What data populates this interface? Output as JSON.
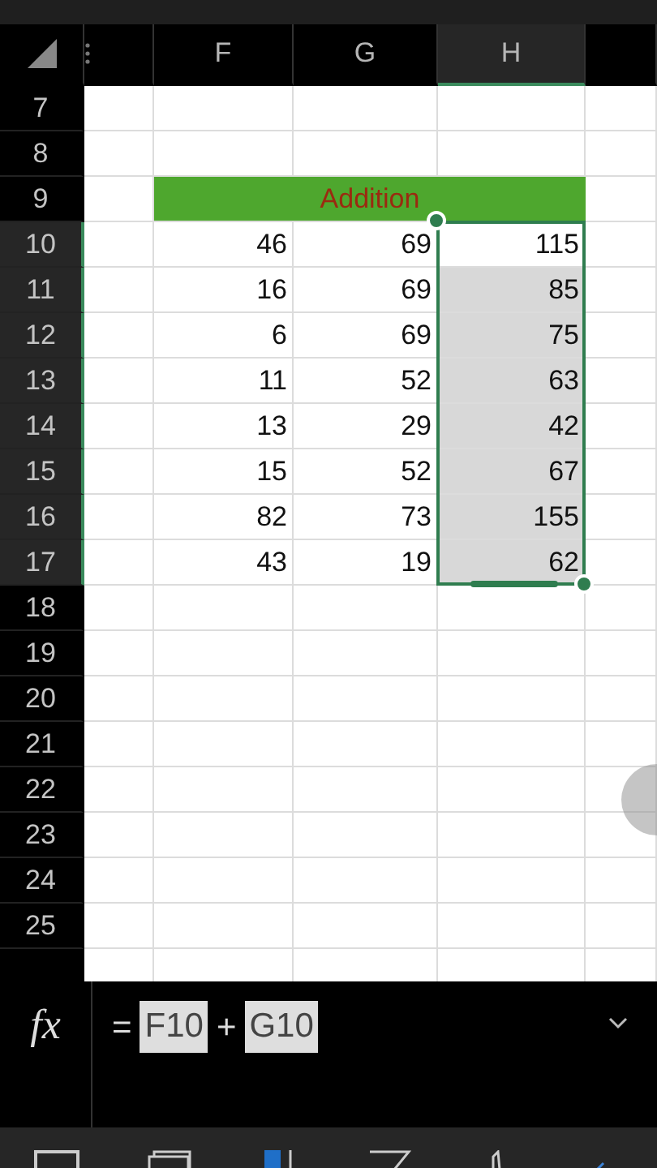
{
  "columns": [
    {
      "label": "F",
      "selected": false
    },
    {
      "label": "G",
      "selected": false
    },
    {
      "label": "H",
      "selected": true
    }
  ],
  "rows": [
    {
      "number": "7",
      "kind": "blank",
      "selected": false
    },
    {
      "number": "8",
      "kind": "blank",
      "selected": false
    },
    {
      "number": "9",
      "kind": "title",
      "selected": false,
      "title": "Addition"
    },
    {
      "number": "10",
      "kind": "data",
      "selected": true,
      "active": true,
      "cells": [
        "46",
        "69",
        "115"
      ]
    },
    {
      "number": "11",
      "kind": "data",
      "selected": true,
      "active": false,
      "cells": [
        "16",
        "69",
        "85"
      ]
    },
    {
      "number": "12",
      "kind": "data",
      "selected": true,
      "active": false,
      "cells": [
        "6",
        "69",
        "75"
      ]
    },
    {
      "number": "13",
      "kind": "data",
      "selected": true,
      "active": false,
      "cells": [
        "11",
        "52",
        "63"
      ]
    },
    {
      "number": "14",
      "kind": "data",
      "selected": true,
      "active": false,
      "cells": [
        "13",
        "29",
        "42"
      ]
    },
    {
      "number": "15",
      "kind": "data",
      "selected": true,
      "active": false,
      "cells": [
        "15",
        "52",
        "67"
      ]
    },
    {
      "number": "16",
      "kind": "data",
      "selected": true,
      "active": false,
      "cells": [
        "82",
        "73",
        "155"
      ]
    },
    {
      "number": "17",
      "kind": "data",
      "selected": true,
      "active": false,
      "cells": [
        "43",
        "19",
        "62"
      ]
    },
    {
      "number": "18",
      "kind": "blank",
      "selected": false
    },
    {
      "number": "19",
      "kind": "blank",
      "selected": false
    },
    {
      "number": "20",
      "kind": "blank",
      "selected": false
    },
    {
      "number": "21",
      "kind": "blank",
      "selected": false
    },
    {
      "number": "22",
      "kind": "blank",
      "selected": false
    },
    {
      "number": "23",
      "kind": "blank",
      "selected": false
    },
    {
      "number": "24",
      "kind": "blank",
      "selected": false
    },
    {
      "number": "25",
      "kind": "blank",
      "selected": false
    }
  ],
  "formula_bar": {
    "label": "fx",
    "parts": [
      {
        "text": "=",
        "kind": "operator"
      },
      {
        "text": "F10",
        "kind": "ref"
      },
      {
        "text": "+",
        "kind": "operator"
      },
      {
        "text": "G10",
        "kind": "ref"
      }
    ]
  }
}
